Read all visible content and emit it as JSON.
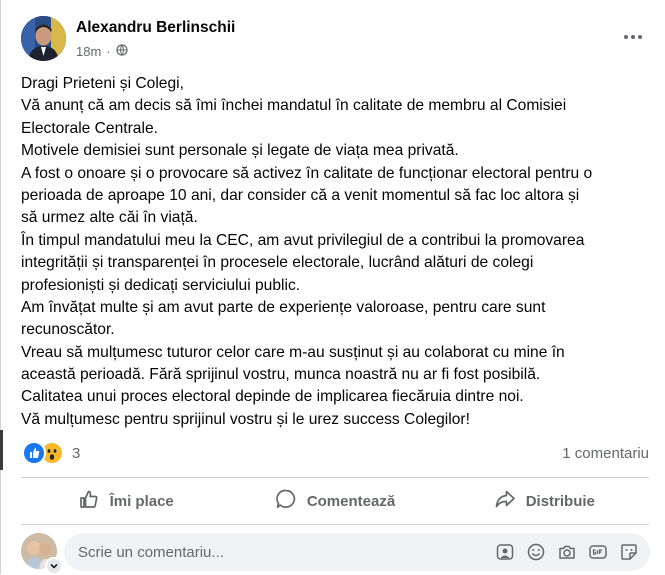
{
  "post": {
    "author": "Alexandru Berlinschii",
    "time": "18m",
    "lines": [
      "Dragi Prieteni și Colegi,",
      "Vă anunț că am decis să îmi închei mandatul în calitate de membru al Comisiei",
      "Electorale Centrale.",
      "Motivele demisiei sunt personale și legate de viața mea privată.",
      "A fost o onoare și o provocare să activez în calitate de funcționar electoral pentru o",
      "perioada de aproape 10 ani, dar consider că a venit momentul să fac loc altora și",
      "să urmez alte căi în viață.",
      "În timpul mandatului meu la CEC, am avut privilegiul de a contribui la promovarea",
      "integrității și transparenței în procesele electorale, lucrând alături de colegi",
      "profesioniști și dedicați serviciului public.",
      "Am învățat multe și am avut parte de experiențe valoroase, pentru care sunt",
      "recunoscător.",
      "Vreau să mulțumesc tuturor celor care m-au susținut și au colaborat cu mine în",
      "această perioadă. Fără sprijinul vostru, munca noastră nu ar fi fost posibilă.",
      "Calitatea unui proces electoral depinde de implicarea fiecăruia dintre noi.",
      "Vă mulțumesc  pentru sprijinul vostru și le urez success Colegilor!"
    ]
  },
  "reactions": {
    "count": "3",
    "types": [
      "like",
      "wow"
    ]
  },
  "comments_count": "1 comentariu",
  "actions": {
    "like": "Îmi place",
    "comment": "Comentează",
    "share": "Distribuie"
  },
  "comment_box": {
    "placeholder": "Scrie un comentariu..."
  },
  "colors": {
    "like_blue": "#1877f2",
    "wow_yellow": "#f7b928",
    "secondary_text": "#65676b"
  }
}
